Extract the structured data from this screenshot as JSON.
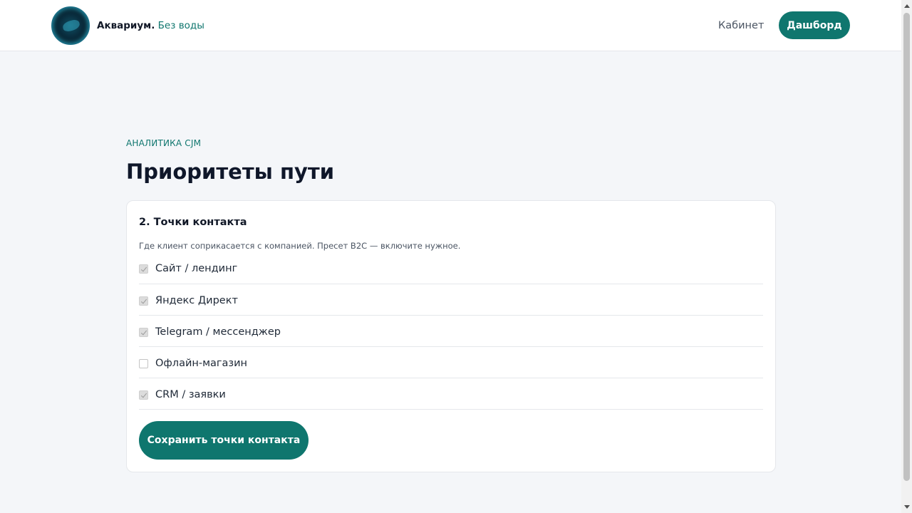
{
  "header": {
    "brand_name": "Аквариум.",
    "brand_tagline": "Без воды",
    "nav_link": "Кабинет",
    "nav_button": "Дашборд"
  },
  "page": {
    "eyebrow": "АНАЛИТИКА CJM",
    "title": "Приоритеты пути"
  },
  "card": {
    "title": "2. Точки контакта",
    "hint": "Где клиент соприкасается с компанией. Пресет B2C — включите нужное.",
    "options": [
      {
        "label": "Сайт / лендинг",
        "checked": true
      },
      {
        "label": "Яндекс Директ",
        "checked": true
      },
      {
        "label": "Telegram / мессенджер",
        "checked": true
      },
      {
        "label": "Офлайн-магазин",
        "checked": false
      },
      {
        "label": "CRM / заявки",
        "checked": true
      }
    ],
    "save_button": "Сохранить точки контакта"
  },
  "colors": {
    "accent": "#0f766e",
    "background": "#f4f6f9"
  }
}
